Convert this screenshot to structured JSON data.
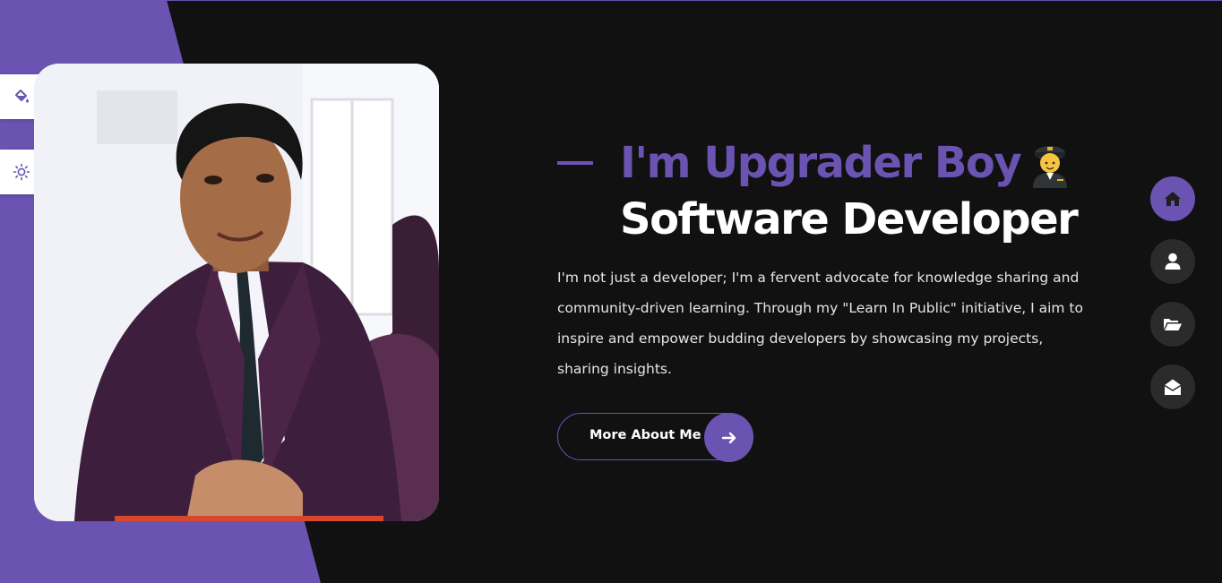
{
  "hero": {
    "intro": "I'm Upgrader Boy",
    "role": "Software Developer",
    "emoji_icon": "pilot-emoji",
    "description": "I'm not just a developer; I'm a fervent advocate for knowledge sharing and community-driven learning. Through my \"Learn In Public\" initiative, I aim to inspire and empower budding developers by showcasing my projects, sharing insights.",
    "button_label": "More About Me"
  },
  "tools": [
    {
      "icon": "paint-bucket-icon"
    },
    {
      "icon": "sun-icon"
    }
  ],
  "nav": [
    {
      "icon": "home-icon",
      "active": true
    },
    {
      "icon": "user-icon",
      "active": false
    },
    {
      "icon": "folder-open-icon",
      "active": false
    },
    {
      "icon": "envelope-open-icon",
      "active": false
    }
  ],
  "colors": {
    "accent": "#6a53b1",
    "background": "#111111",
    "nav_inactive": "#2b2b2b",
    "text": "#ffffff"
  }
}
